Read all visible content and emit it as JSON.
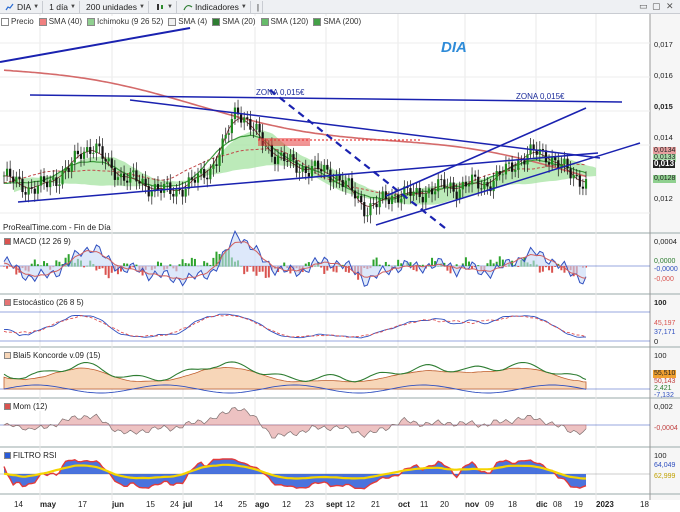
{
  "toolbar": {
    "symbol": "DIA",
    "interval": "1 día",
    "units": "200 unidades",
    "indicators": "Indicadores",
    "extra": "|"
  },
  "legend": [
    {
      "label": "Precio",
      "color": "#ffffff"
    },
    {
      "label": "SMA (40)",
      "color": "#f08080"
    },
    {
      "label": "Ichimoku (9 26 52)",
      "color": "#90d090"
    },
    {
      "label": "SMA (4)",
      "color": "#f0f0f0"
    },
    {
      "label": "SMA (20)",
      "color": "#2e7d32"
    },
    {
      "label": "SMA (120)",
      "color": "#66bb6a"
    },
    {
      "label": "SMA (200)",
      "color": "#43a047"
    }
  ],
  "main": {
    "ticker_label": "DIA",
    "zone_label_1": "ZONA 0,015€",
    "zone_label_2": "ZONA 0,015€",
    "source_note": "ProRealTime.com - Fin de Día",
    "yticks": [
      "0,017",
      "0,016",
      "0,015",
      "0,014",
      "0,012"
    ],
    "tags": [
      "0,0134",
      "0,0133",
      "0,013",
      "0,0128"
    ]
  },
  "panels": {
    "macd": {
      "label": "MACD (12 26 9)",
      "yticks": [
        "0,0004"
      ],
      "tags": [
        "0,0000",
        "-0,0000",
        "-0,000"
      ]
    },
    "stoch": {
      "label": "Estocástico (26 8 5)",
      "yticks": [
        "100",
        "0"
      ],
      "tags": [
        "45,197",
        "37,171"
      ]
    },
    "blai5": {
      "label": "Blai5 Koncorde v.09 (15)",
      "yticks": [
        "100"
      ],
      "tags": [
        "55,510",
        "50,143",
        "2,421",
        "-7,132"
      ]
    },
    "mom": {
      "label": "Mom (12)",
      "yticks": [
        "0,002"
      ],
      "tags": [
        "-0,0004"
      ]
    },
    "rsi": {
      "label": "FILTRO RSI",
      "yticks": [
        "100"
      ],
      "tags": [
        "64,049",
        "62,999"
      ]
    }
  },
  "xaxis": {
    "labels": [
      "14",
      "may",
      "17",
      "jun",
      "15",
      "24",
      "jul",
      "14",
      "25",
      "ago",
      "12",
      "23",
      "sept",
      "12",
      "21",
      "oct",
      "11",
      "20",
      "nov",
      "09",
      "18",
      "dic",
      "08",
      "19",
      "2023",
      "18"
    ]
  },
  "chart_data": {
    "type": "candlestick",
    "title": "DIA",
    "price_ylim": [
      0.0115,
      0.0175
    ],
    "price_axis_ticks": [
      0.017,
      0.016,
      0.015,
      0.014,
      0.012
    ],
    "last_values": {
      "price": 0.013,
      "sma_tags": [
        0.0134,
        0.0133,
        0.0128
      ]
    },
    "resistance_zone": 0.015,
    "months": [
      "may",
      "jun",
      "jul",
      "ago",
      "sept",
      "oct",
      "nov",
      "dic",
      "2023"
    ],
    "close_approx": [
      0.0131,
      0.0129,
      0.0127,
      0.0128,
      0.013,
      0.0133,
      0.0138,
      0.014,
      0.0134,
      0.0131,
      0.013,
      0.0128,
      0.0127,
      0.0126,
      0.0128,
      0.013,
      0.0133,
      0.014,
      0.0151,
      0.0146,
      0.0141,
      0.0137,
      0.0135,
      0.0133,
      0.0133,
      0.0132,
      0.013,
      0.0126,
      0.0121,
      0.0123,
      0.0125,
      0.0126,
      0.0125,
      0.0127,
      0.0128,
      0.0127,
      0.0129,
      0.0128,
      0.013,
      0.0133,
      0.0136,
      0.0138,
      0.0137,
      0.0134,
      0.0131,
      0.0129
    ],
    "macd_ticks": [
      0.0004,
      0.0
    ],
    "stoch_ticks": [
      100,
      0
    ],
    "stoch_last": [
      45.197,
      37.171
    ],
    "koncorde_tags": [
      55.51,
      50.143,
      2.421,
      -7.132
    ],
    "mom_ticks": [
      0.002
    ],
    "mom_last": -0.0004,
    "rsi_last": [
      64.049,
      62.999
    ]
  },
  "colors": {
    "trendline": "#1a22b0",
    "candle_up": "#1e8a1e",
    "candle_down": "#111111",
    "ichimoku_cloud": "#a6e3a1",
    "ichimoku_cloud_red": "#f2b3ad",
    "sma_red": "#d46a6a",
    "sma_green": "#3d9b3d",
    "macd_pos": "#2ea32e",
    "macd_neg": "#d9534f",
    "koncorde_fill": "#f7d6b8",
    "rsi_yellow": "#f5d400",
    "rsi_blue": "#2a5bd7",
    "rsi_red": "#e23b3b"
  }
}
